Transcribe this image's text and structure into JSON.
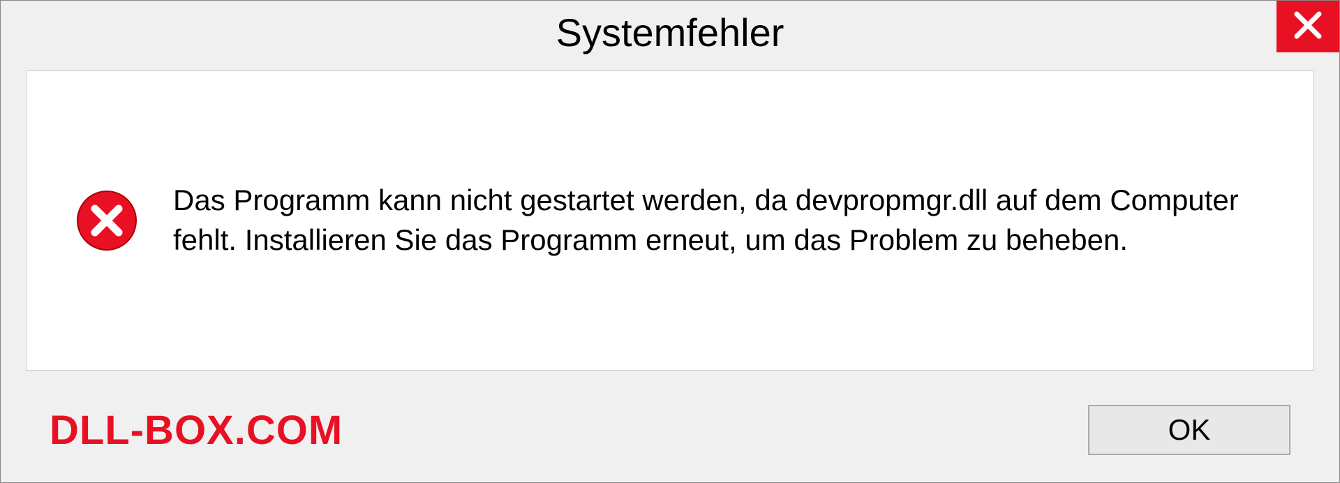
{
  "dialog": {
    "title": "Systemfehler",
    "message": "Das Programm kann nicht gestartet werden, da devpropmgr.dll auf dem Computer fehlt. Installieren Sie das Programm erneut, um das Problem zu beheben.",
    "ok_label": "OK"
  },
  "watermark": "DLL-BOX.COM"
}
